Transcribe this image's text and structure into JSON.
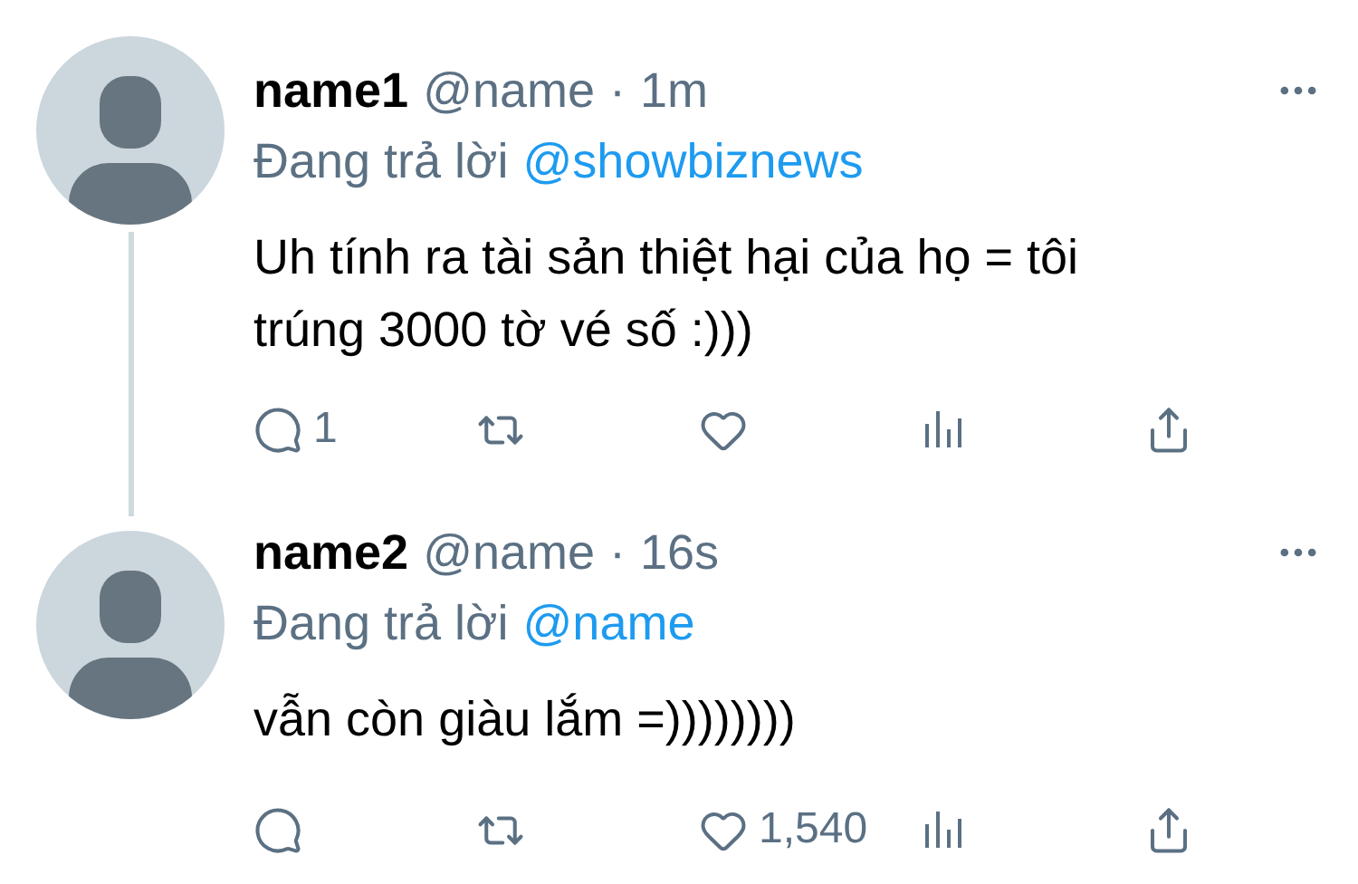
{
  "tweets": [
    {
      "name": "name1",
      "handle": "@name",
      "separator": "·",
      "time": "1m",
      "reply_prefix": "Đang trả lời",
      "reply_to": "@showbiznews",
      "text": "Uh tính ra tài sản thiệt hại của họ = tôi\ntrúng 3000 tờ vé số :)))",
      "thread_line": true,
      "actions": [
        {
          "kind": "reply",
          "count": "1"
        },
        {
          "kind": "retweet"
        },
        {
          "kind": "like"
        },
        {
          "kind": "analytics"
        },
        {
          "kind": "share"
        }
      ]
    },
    {
      "name": "name2",
      "handle": "@name",
      "separator": "·",
      "time": "16s",
      "reply_prefix": "Đang trả lời",
      "reply_to": "@name",
      "text": "vẫn còn giàu lắm =))))))))",
      "thread_line": false,
      "actions": [
        {
          "kind": "reply"
        },
        {
          "kind": "retweet"
        },
        {
          "kind": "like",
          "count": "1,540"
        },
        {
          "kind": "analytics"
        },
        {
          "kind": "share"
        }
      ]
    }
  ]
}
